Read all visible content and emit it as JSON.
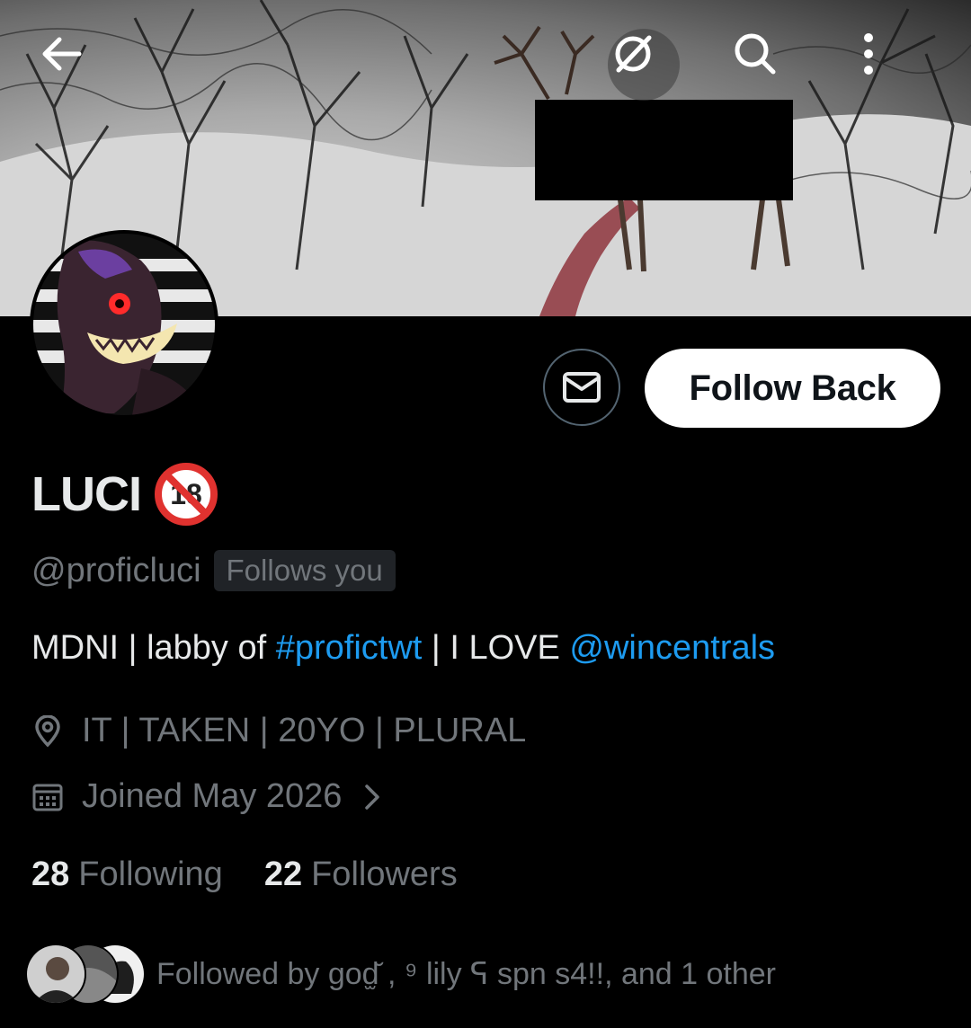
{
  "header": {
    "back_icon": "arrow-left-icon",
    "grok_icon": "grok-icon",
    "search_icon": "search-icon",
    "more_icon": "more-vertical-icon"
  },
  "profile": {
    "display_name": "LUCI",
    "age_badge": "18",
    "handle": "@proficluci",
    "follows_you": "Follows you",
    "bio": {
      "part1": "MDNI | labby of ",
      "hashtag": "#profictwt",
      "part2": " | I LOVE ",
      "mention": "@wincentrals"
    },
    "location": "IT | TAKEN | 20YO | PLURAL",
    "joined": "Joined May 2026"
  },
  "actions": {
    "message_icon": "envelope-icon",
    "follow_label": "Follow Back"
  },
  "stats": {
    "following_count": "28",
    "following_label": "Following",
    "followers_count": "22",
    "followers_label": "Followers"
  },
  "followed_by": {
    "text": "Followed by god̫̆ ,  ⁹ lily ᕋ spn s4!!, and 1 other"
  },
  "colors": {
    "background": "#000000",
    "text": "#e7e9ea",
    "secondary_text": "#71767b",
    "link": "#1d9bf0",
    "follow_button_bg": "#ffffff"
  }
}
